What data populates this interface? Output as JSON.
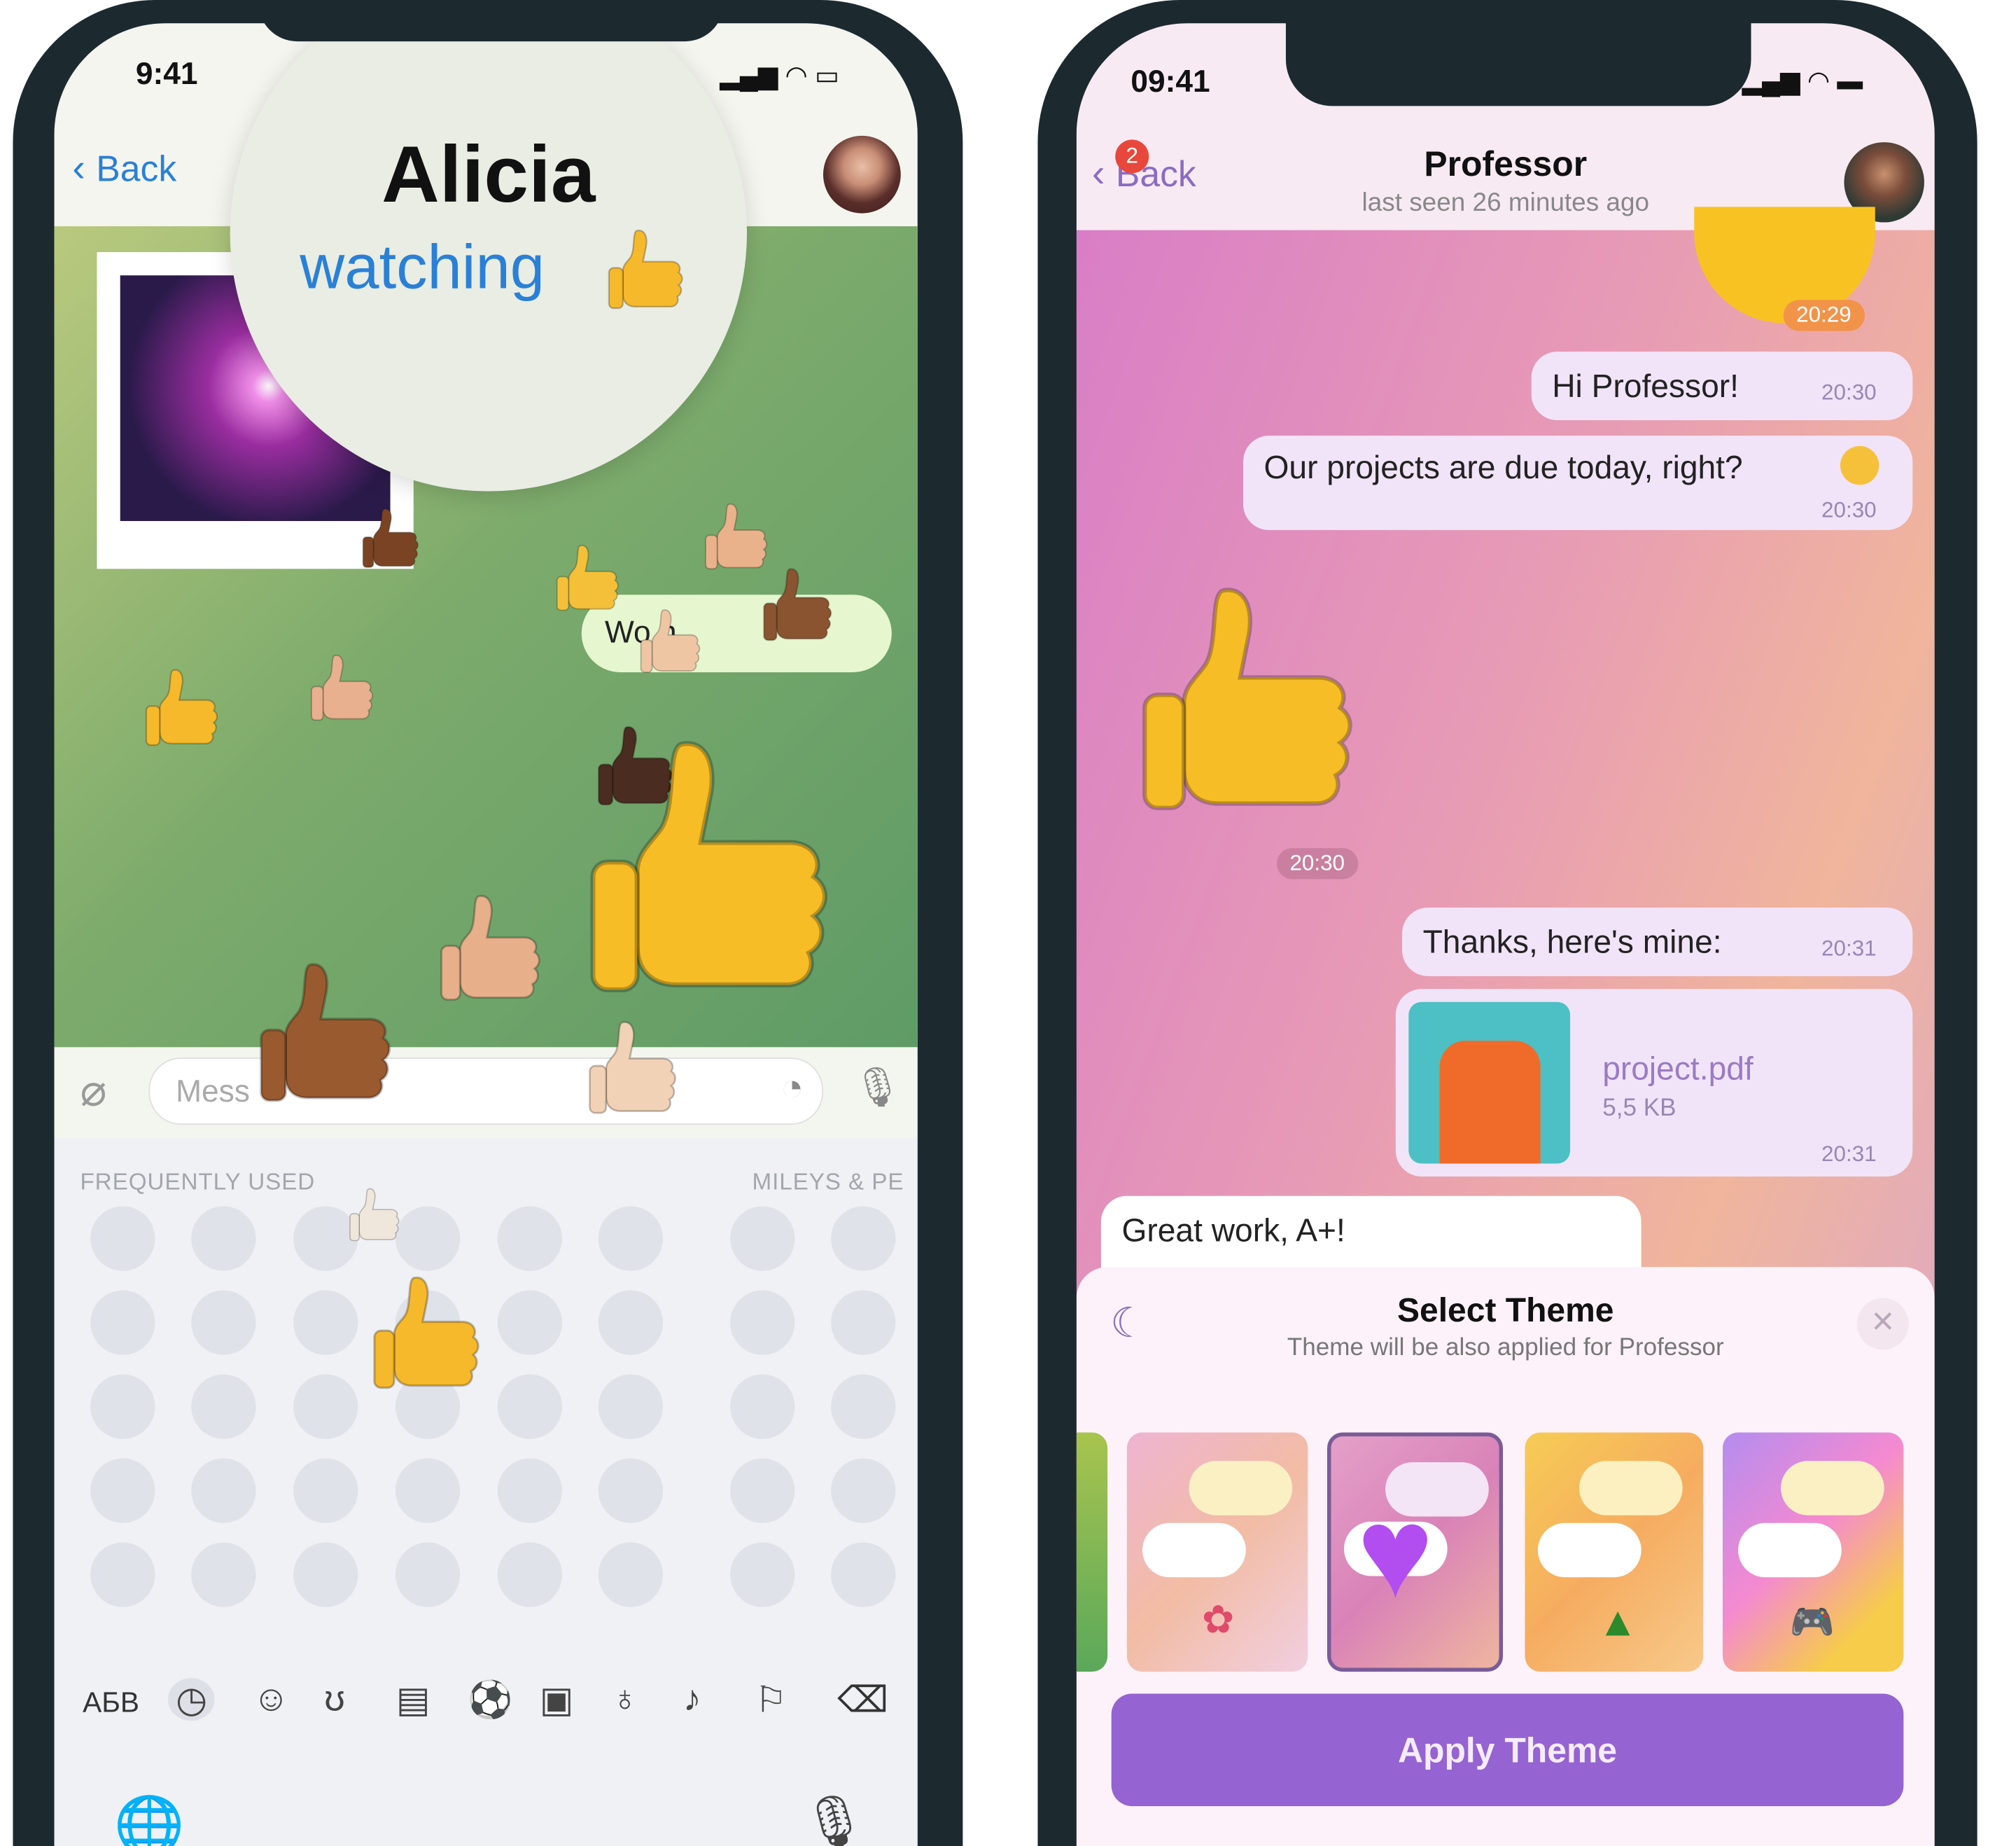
{
  "left_phone": {
    "status_time": "9:41",
    "back_label": "Back",
    "contact_name": "Alicia",
    "contact_status": "watching",
    "bubble_text": "Wo h",
    "input_placeholder": "Mess",
    "keyboard": {
      "section_frequent": "FREQUENTLY USED",
      "section_smileys": "MILEYS & PE",
      "abc_label": "АБВ",
      "categories": [
        "recent-icon",
        "smiley-icon",
        "animal-icon",
        "food-icon",
        "ball-icon",
        "car-icon",
        "bulb-icon",
        "symbols-icon",
        "flag-icon"
      ]
    }
  },
  "right_phone": {
    "status_time": "09:41",
    "back_label": "Back",
    "back_badge": "2",
    "contact_name": "Professor",
    "contact_status": "last seen 26 minutes ago",
    "messages": [
      {
        "text": "",
        "time": "20:29",
        "type": "sticker"
      },
      {
        "text": "Hi Professor!",
        "time": "20:30",
        "type": "outgoing"
      },
      {
        "text": "Our projects are due today, right?",
        "time": "20:30",
        "type": "outgoing"
      },
      {
        "text": "",
        "time": "20:30",
        "type": "sticker"
      },
      {
        "text": "Thanks, here's mine:",
        "time": "20:31",
        "type": "outgoing"
      },
      {
        "file_name": "project.pdf",
        "file_size": "5,5 KB",
        "time": "20:31",
        "type": "file"
      },
      {
        "text": "Great work, A+!",
        "type": "incoming"
      }
    ],
    "theme_sheet": {
      "title": "Select Theme",
      "subtitle": "Theme will be also applied for Professor",
      "themes": [
        {
          "emoji": "rose",
          "selected": false
        },
        {
          "emoji": "purple-heart",
          "selected": true
        },
        {
          "emoji": "christmas-tree",
          "selected": false
        },
        {
          "emoji": "game-controller",
          "selected": false
        }
      ],
      "apply_label": "Apply Theme"
    }
  },
  "colors": {
    "accent_blue": "#2a80d6",
    "accent_purple": "#9563d2",
    "badge_red": "#e8483b"
  }
}
